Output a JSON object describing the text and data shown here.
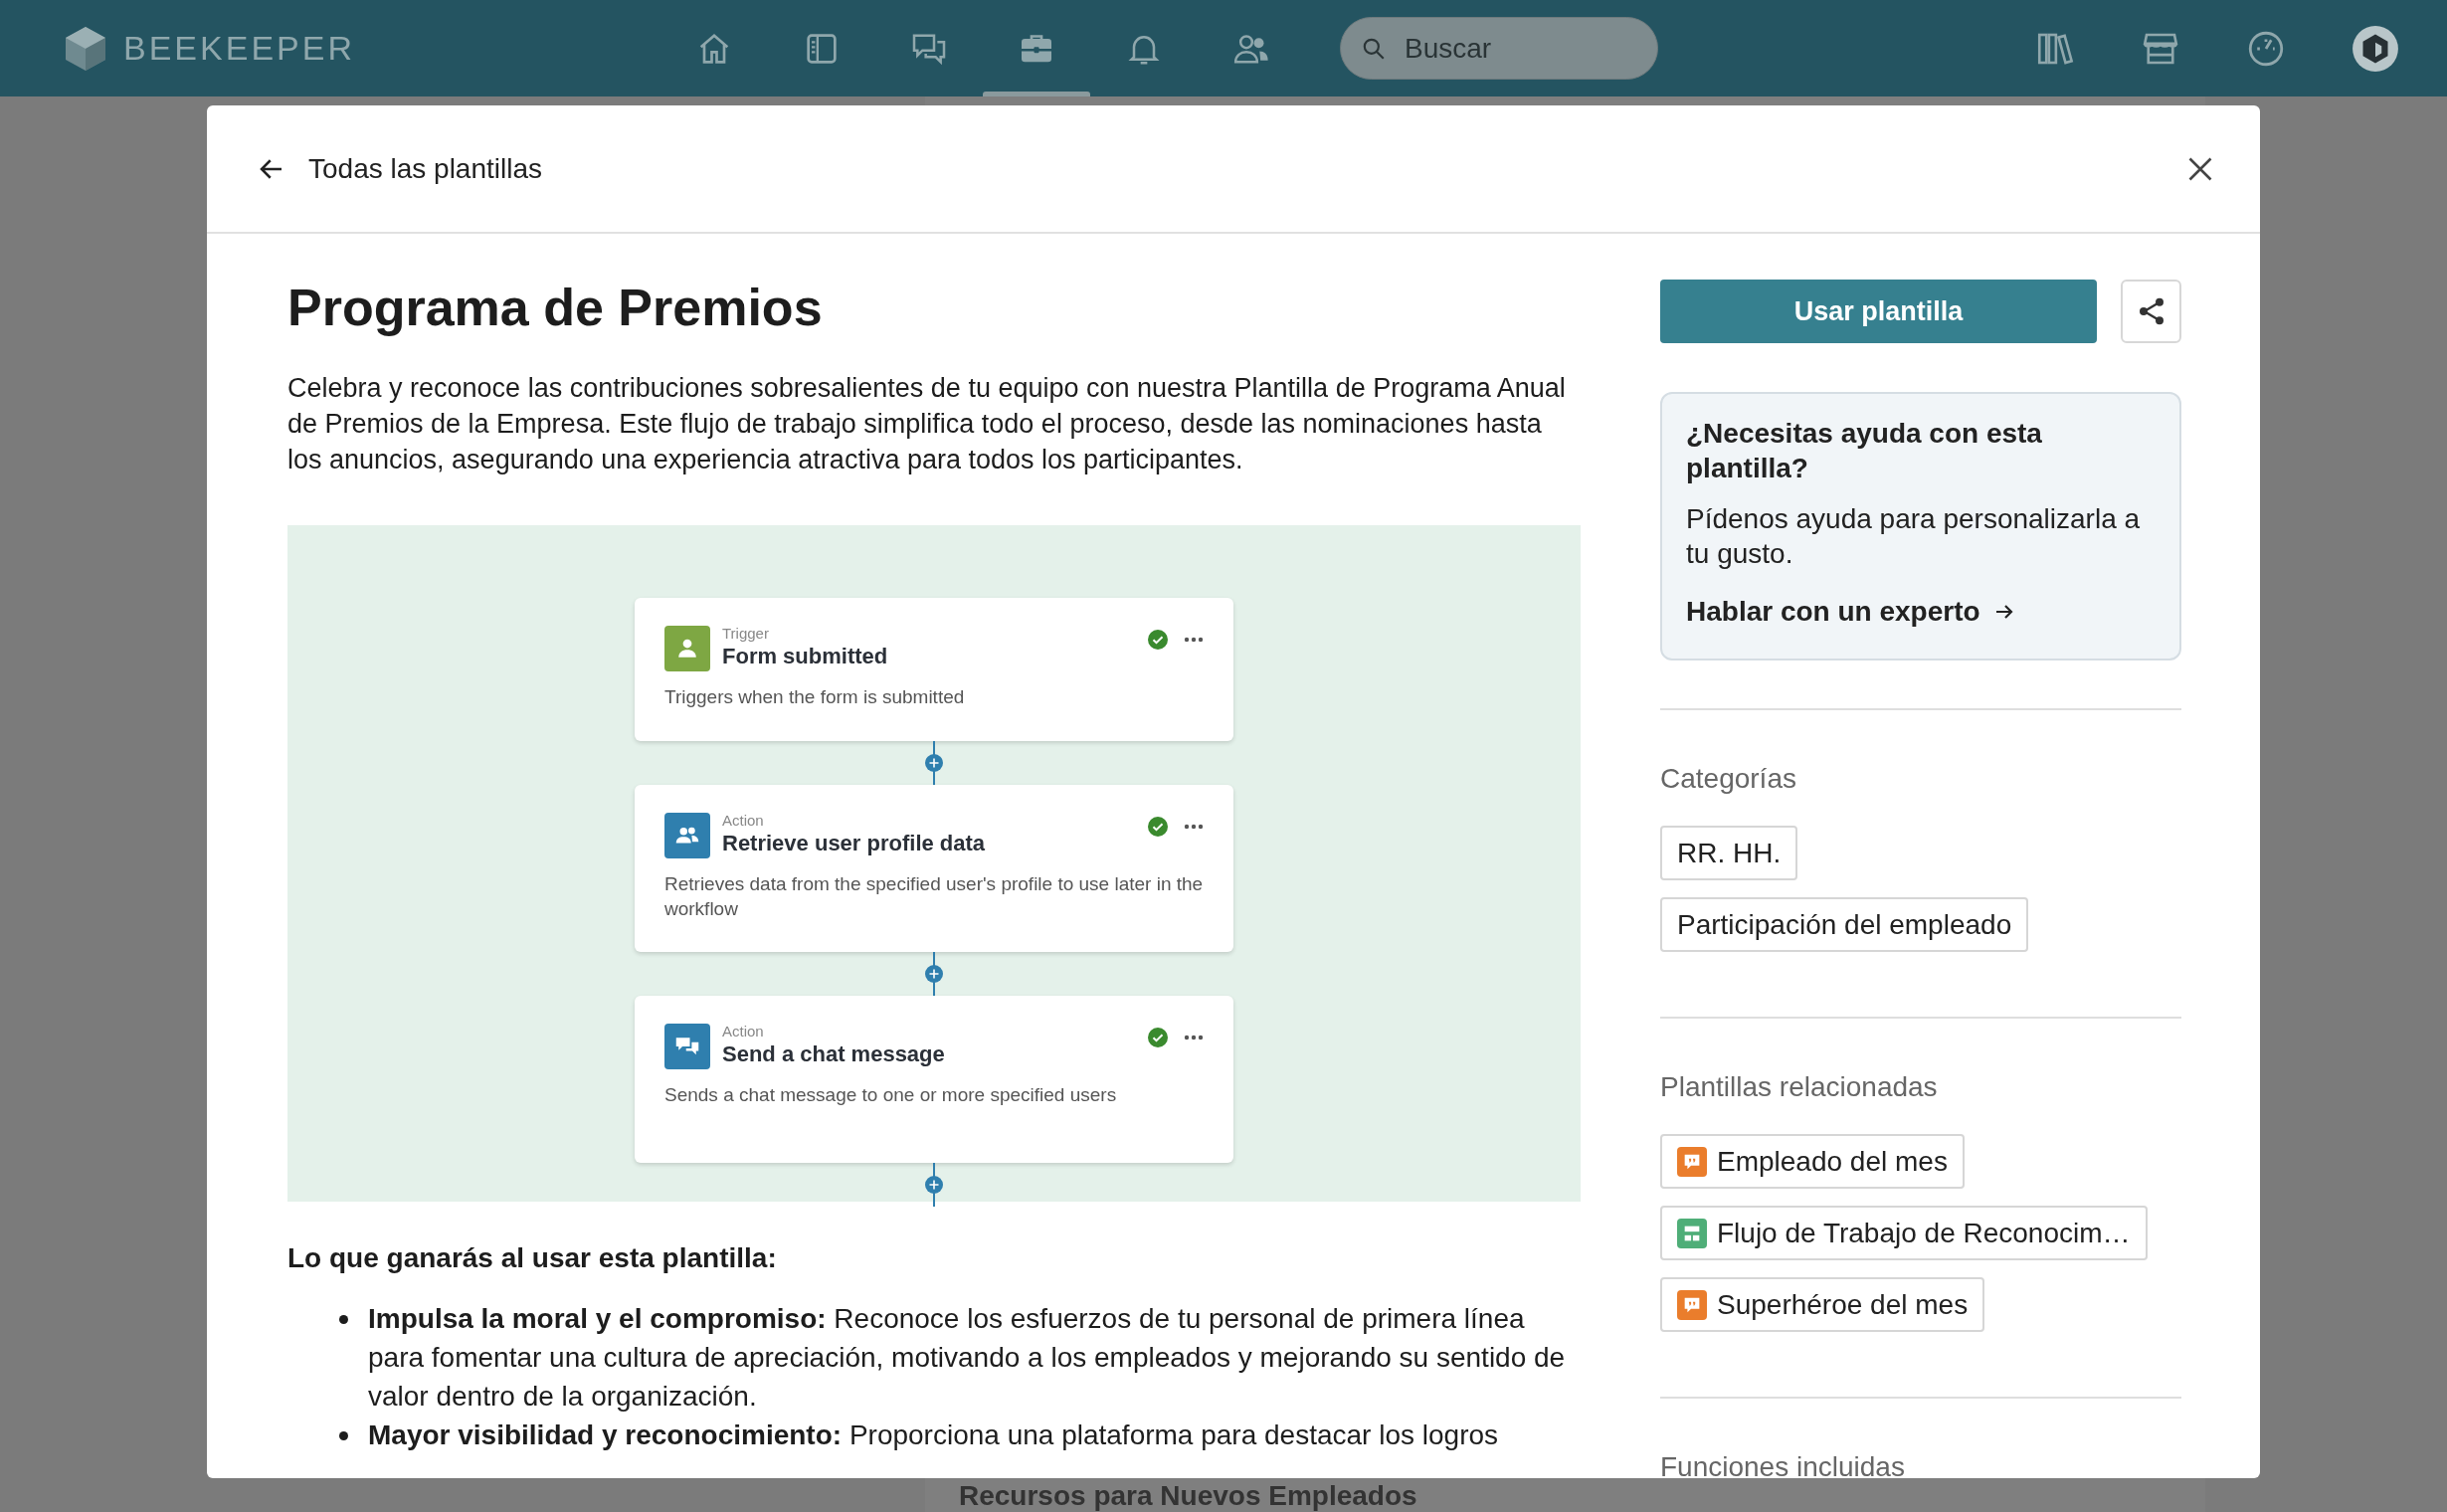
{
  "topbar": {
    "brand": "BEEKEEPER",
    "nav": [
      {
        "kind": "home",
        "selected": false
      },
      {
        "kind": "journal",
        "selected": false
      },
      {
        "kind": "chat",
        "selected": false
      },
      {
        "kind": "briefcase",
        "selected": true
      },
      {
        "kind": "bell",
        "selected": false
      },
      {
        "kind": "people",
        "selected": false
      }
    ],
    "search": {
      "placeholder": "Buscar"
    },
    "tools": [
      {
        "kind": "library"
      },
      {
        "kind": "store"
      },
      {
        "kind": "dashboard"
      },
      {
        "kind": "avatar"
      }
    ]
  },
  "modal": {
    "back_label": "Todas las plantillas",
    "title": "Programa de Premios",
    "description": "Celebra y reconoce las contribuciones sobresalientes de tu equipo con nuestra Plantilla de Programa Anual de Premios de la Empresa. Este flujo de trabajo simplifica todo el proceso, desde las nominaciones hasta los anuncios, asegurando una experiencia atractiva para todos los participantes.",
    "workflow": {
      "steps": [
        {
          "kind": "person",
          "type": "Trigger",
          "title": "Form submitted",
          "description": "Triggers when the form is submitted",
          "completed": true
        },
        {
          "kind": "people",
          "type": "Action",
          "title": "Retrieve user profile data",
          "description": "Retrieves data from the specified user's profile to use later in the workflow",
          "completed": true
        },
        {
          "kind": "chat",
          "type": "Action",
          "title": "Send a chat message",
          "description": "Sends a chat message to one or more specified users",
          "completed": true
        }
      ]
    },
    "benefits": {
      "heading": "Lo que ganarás al usar esta plantilla:",
      "items": [
        "**Impulsa la moral y el compromiso:** Reconoce los esfuerzos de tu personal de primera línea para fomentar una cultura de apreciación, motivando a los empleados y mejorando su sentido de valor dentro de la organización.",
        "**Mayor visibilidad y reconocimiento:** Proporciona una plataforma para destacar los logros"
      ]
    },
    "primary_button": "Usar plantilla",
    "help": {
      "title": "¿Necesitas ayuda con esta plantilla?",
      "text": "Pídenos ayuda para personalizarla a tu gusto.",
      "link": "Hablar con un experto"
    },
    "categories": {
      "heading": "Categorías",
      "items": [
        "RR. HH.",
        "Participación del empleado"
      ]
    },
    "related": {
      "heading": "Plantillas relacionadas",
      "items": [
        {
          "kind": "quote",
          "label": "Empleado del mes"
        },
        {
          "kind": "workflow",
          "label": "Flujo de Trabajo de Reconocim…"
        },
        {
          "kind": "quote",
          "label": "Superhéroe del mes"
        }
      ]
    },
    "features": {
      "heading": "Funciones incluidas"
    }
  },
  "background": {
    "heading": "Recursos para Nuevos Empleados"
  }
}
